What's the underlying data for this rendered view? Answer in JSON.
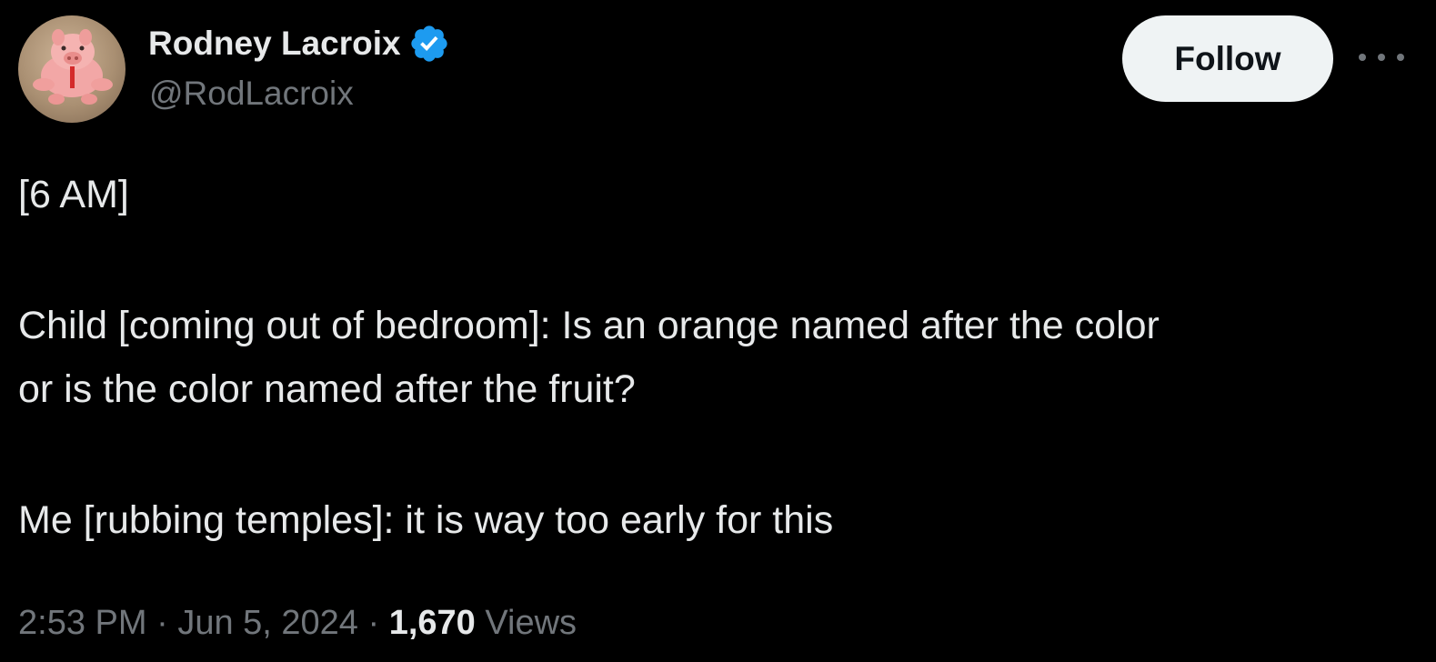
{
  "author": {
    "display_name": "Rodney Lacroix",
    "handle": "@RodLacroix",
    "verified": true,
    "verified_color": "#1d9bf0",
    "avatar_icon": "pig-figurine-avatar"
  },
  "actions": {
    "follow_label": "Follow",
    "more_icon": "more-horizontal-icon"
  },
  "tweet": {
    "lines": [
      "[6 AM]",
      "Child [coming out of bedroom]: Is an orange named after the color",
      "or is the color named after the fruit?",
      "Me [rubbing temples]: it is way too early for this"
    ]
  },
  "meta": {
    "time": "2:53 PM",
    "separator": "·",
    "date": "Jun 5, 2024",
    "views_count": "1,670",
    "views_label": "Views"
  },
  "colors": {
    "background": "#000000",
    "text_primary": "#e7e9ea",
    "text_secondary": "#71767b",
    "follow_bg": "#eff3f4",
    "follow_text": "#0f1419"
  }
}
